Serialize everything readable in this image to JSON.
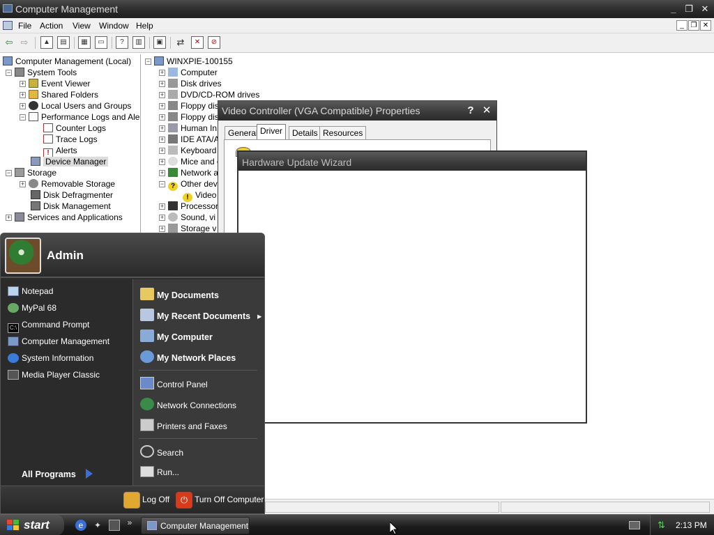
{
  "window": {
    "title": "Computer Management",
    "minimize": "_",
    "restore": "❐",
    "close": "✕"
  },
  "menu": {
    "items": [
      "File",
      "Action",
      "View",
      "Window",
      "Help"
    ],
    "mdi_min": "_",
    "mdi_restore": "❐",
    "mdi_close": "✕"
  },
  "toolbar": {
    "back": "⇦",
    "forward": "⇨"
  },
  "left_tree": {
    "root": "Computer Management (Local)",
    "system_tools": "System Tools",
    "event_viewer": "Event Viewer",
    "shared_folders": "Shared Folders",
    "local_users": "Local Users and Groups",
    "perf_logs": "Performance Logs and Alerts",
    "counter_logs": "Counter Logs",
    "trace_logs": "Trace Logs",
    "alerts": "Alerts",
    "device_manager": "Device Manager",
    "storage": "Storage",
    "removable_storage": "Removable Storage",
    "disk_defrag": "Disk Defragmenter",
    "disk_mgmt": "Disk Management",
    "services_apps": "Services and Applications"
  },
  "device_tree": {
    "root": "WINXPIE-100155",
    "items": [
      "Computer",
      "Disk drives",
      "DVD/CD-ROM drives",
      "Floppy dis",
      "Floppy dis",
      "Human In",
      "IDE ATA/A",
      "Keyboard",
      "Mice and o",
      "Network a",
      "Other dev",
      "Video",
      "Processor",
      "Sound, vi",
      "Storage v"
    ]
  },
  "vc_dialog": {
    "title": "Video Controller (VGA Compatible) Properties",
    "help": "?",
    "close": "✕",
    "tabs": [
      "General",
      "Driver",
      "Details",
      "Resources"
    ]
  },
  "hw_wizard": {
    "title": "Hardware Update Wizard"
  },
  "start_menu": {
    "user": "Admin",
    "left_items": [
      "Notepad",
      "MyPal 68",
      "Command Prompt",
      "Computer Management",
      "System Information",
      "Media Player Classic"
    ],
    "all_programs": "All Programs",
    "right_bold": [
      "My Documents",
      "My Recent Documents",
      "My Computer",
      "My Network Places"
    ],
    "right_items": [
      "Control Panel",
      "Network Connections",
      "Printers and Faxes"
    ],
    "right_bottom": [
      "Search",
      "Run..."
    ],
    "log_off": "Log Off",
    "turn_off": "Turn Off Computer"
  },
  "taskbar": {
    "start": "start",
    "task": "Computer Management",
    "overflow": "»",
    "clock": "2:13 PM"
  },
  "colors": {
    "title_bar": "#2c2c2c",
    "start_menu_bg": "#2d2d2d",
    "accent_blue": "#3a6fd8"
  }
}
